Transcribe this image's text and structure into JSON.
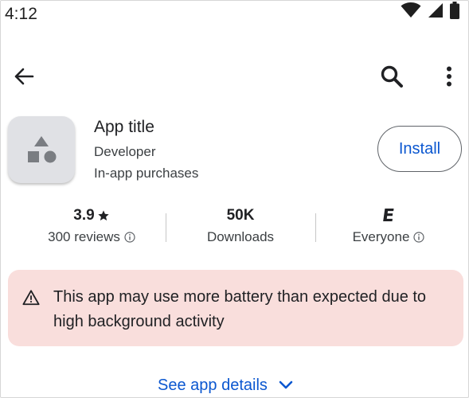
{
  "status_bar": {
    "time": "4:12",
    "icons": [
      "wifi-icon",
      "cellular-signal-icon",
      "battery-icon"
    ]
  },
  "app_bar": {
    "icons": [
      "back-arrow-icon",
      "search-icon",
      "more-vert-icon"
    ]
  },
  "app": {
    "title": "App title",
    "developer": "Developer",
    "in_app": "In-app purchases",
    "install_label": "Install",
    "icon": "shapes-placeholder-icon"
  },
  "stats": {
    "rating": {
      "value": "3.9",
      "sub": "300 reviews",
      "icon": "star-icon",
      "info_icon": "info-icon"
    },
    "downloads": {
      "value": "50K",
      "sub": "Downloads"
    },
    "content_rating": {
      "badge": "E",
      "sub": "Everyone",
      "info_icon": "info-icon"
    }
  },
  "warning": {
    "icon": "warning-triangle-icon",
    "text": "This app may use more battery than expected due to high background activity"
  },
  "details": {
    "label": "See app details",
    "icon": "chevron-down-icon"
  },
  "colors": {
    "accent": "#0b57d0",
    "warning_bg": "#f9dedc",
    "icon_tile": "#e0e1e5"
  }
}
